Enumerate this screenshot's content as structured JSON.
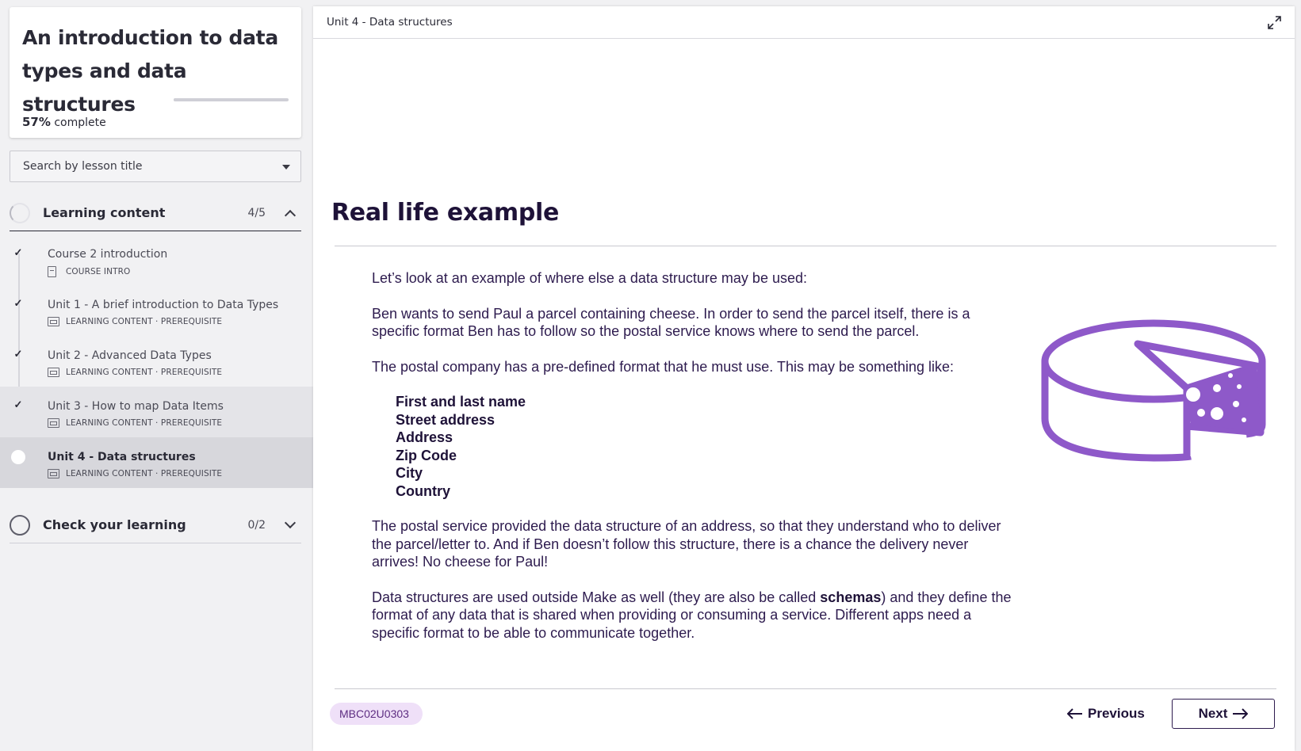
{
  "course": {
    "title": "An introduction to data types and data structures",
    "progress_percent": "57%",
    "progress_suffix": "complete",
    "progress_fraction": 0.57
  },
  "search": {
    "placeholder": "Search by lesson title"
  },
  "sections": [
    {
      "label": "Learning content",
      "count": "4/5",
      "expanded": true,
      "lessons": [
        {
          "title": "Course 2 introduction",
          "meta": "COURSE INTRO",
          "done": true
        },
        {
          "title": "Unit 1 - A brief introduction to Data Types",
          "meta": "LEARNING CONTENT · PREREQUISITE",
          "done": true
        },
        {
          "title": "Unit 2 - Advanced Data Types",
          "meta": "LEARNING CONTENT · PREREQUISITE",
          "done": true
        },
        {
          "title": "Unit 3 - How to map Data Items",
          "meta": "LEARNING CONTENT · PREREQUISITE",
          "done": true
        },
        {
          "title": "Unit 4 - Data structures",
          "meta": "LEARNING CONTENT · PREREQUISITE",
          "done": false,
          "current": true
        }
      ]
    },
    {
      "label": "Check your learning",
      "count": "0/2",
      "expanded": false
    }
  ],
  "main": {
    "breadcrumb": "Unit 4 - Data structures",
    "heading": "Real life example",
    "paragraphs": [
      "Let’s look at an example of where else a data structure may be used:",
      "Ben wants to send Paul a parcel containing cheese. In order to send the parcel itself, there is a specific format Ben has to follow so the postal service knows where to send the parcel.",
      "The postal company has a pre-defined format that he must use. This may be something like:"
    ],
    "list": [
      "First and last name",
      "Street address",
      "Address",
      "Zip Code",
      "City",
      "Country"
    ],
    "paragraph_after_list": "The postal service provided the data structure of an address, so that they understand who to deliver the parcel/letter to. And if Ben doesn’t follow this structure, there is a chance the delivery never arrives! No cheese for Paul!",
    "final_paragraph": {
      "before": "Data structures are used outside Make as well (they are also be called ",
      "bold": "schemas",
      "after": ") and they define the format of any data that is shared when providing or consuming a service. Different apps need a specific format to be able to communicate together."
    },
    "lesson_code": "MBC02U0303",
    "prev_label": "Previous",
    "next_label": "Next"
  },
  "colors": {
    "accent": "#8e59c9",
    "heading": "#1e1238",
    "badge_bg": "#efe0f8"
  },
  "icons": [
    "expand-icon",
    "cheese-icon",
    "check-icon",
    "chevron-up-icon",
    "chevron-down-icon",
    "arrow-left-icon",
    "arrow-right-icon"
  ]
}
